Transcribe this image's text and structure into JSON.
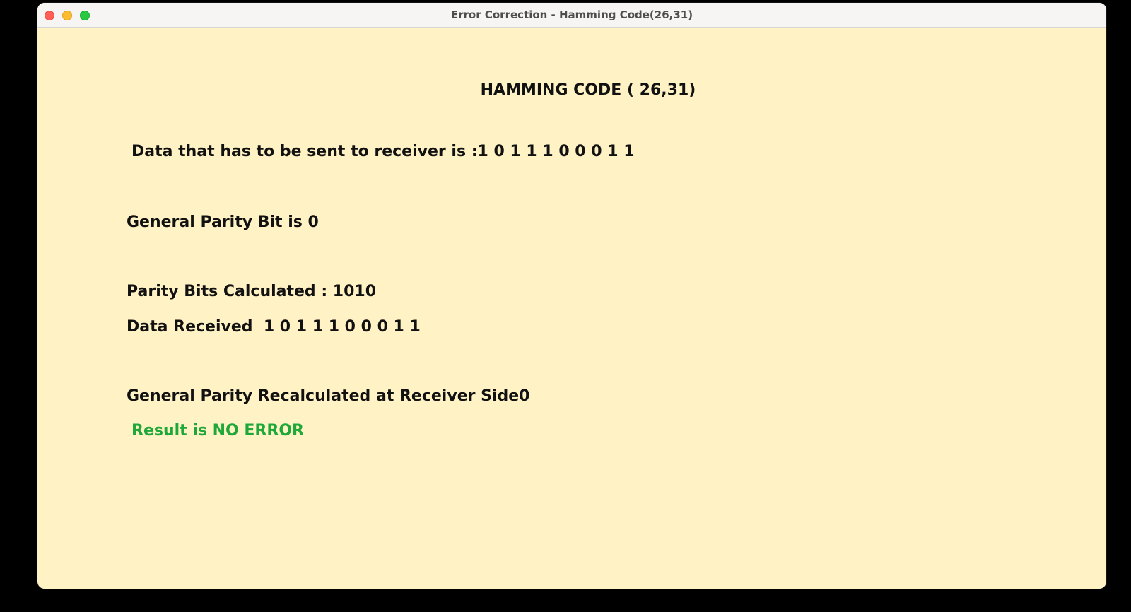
{
  "window": {
    "title": "Error Correction - Hamming Code(26,31)"
  },
  "content": {
    "heading": "HAMMING CODE ( 26,31)",
    "data_sent": "Data that has to be sent to receiver is :1 0 1 1 1 0 0 0 1 1",
    "general_parity": "General Parity Bit is 0",
    "parity_bits": "Parity Bits Calculated : 1010",
    "data_received": "Data Received  1 0 1 1 1 0 0 0 1 1",
    "parity_recalculated": "General Parity Recalculated at Receiver Side0",
    "result": "Result is NO ERROR"
  },
  "colors": {
    "background": "#fff2c4",
    "text": "#111111",
    "result": "#1fa83a"
  }
}
